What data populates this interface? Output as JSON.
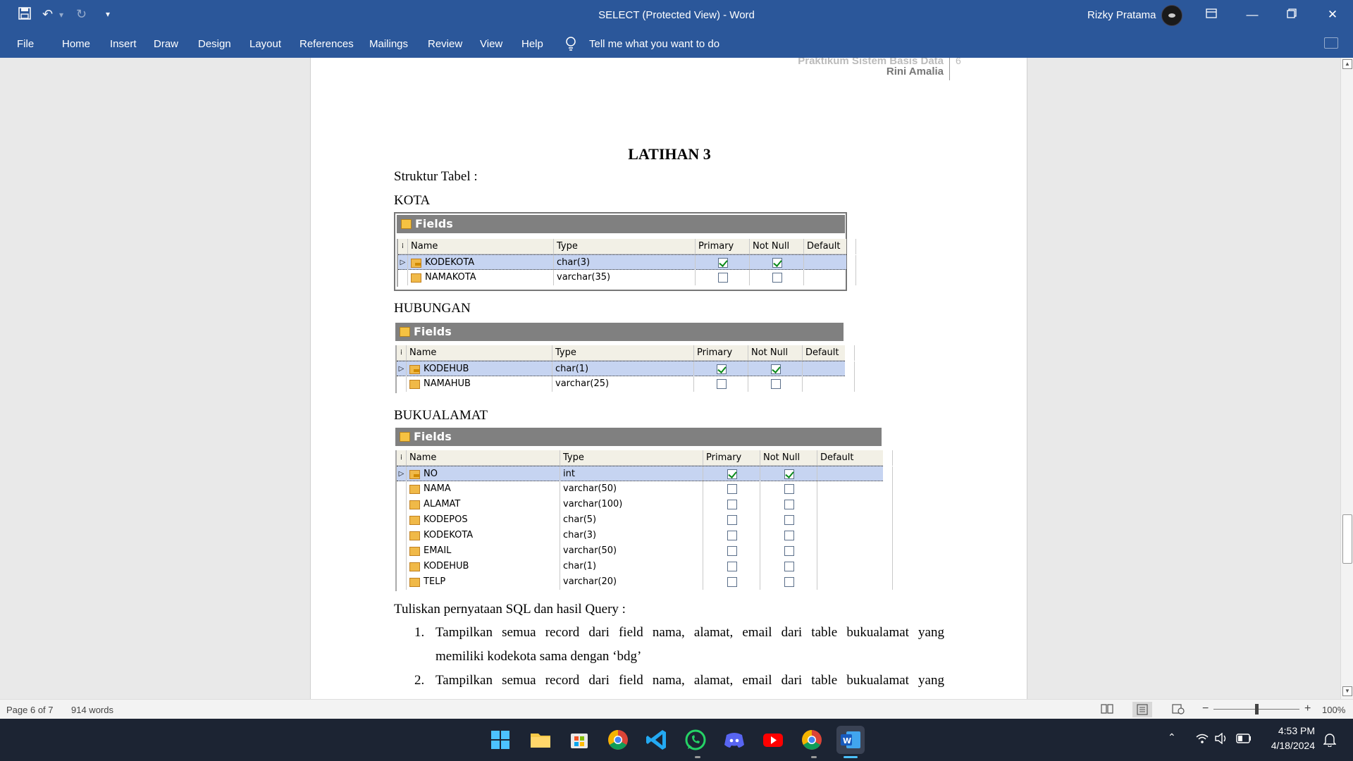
{
  "titlebar": {
    "title": "SELECT (Protected View)  -  Word",
    "user": "Rizky Pratama",
    "quick_access": [
      "save-icon",
      "undo-icon",
      "redo-icon",
      "customize-icon"
    ]
  },
  "ribbon": {
    "tabs": [
      "File",
      "Home",
      "Insert",
      "Draw",
      "Design",
      "Layout",
      "References",
      "Mailings",
      "Review",
      "View",
      "Help"
    ],
    "tell_me": "Tell me what you want to do"
  },
  "document": {
    "header_line1": "Praktikum Sistem Basis Data",
    "header_author": "Rini Amalia",
    "header_page": "6",
    "heading": "LATIHAN 3",
    "struktur": "Struktur Tabel :",
    "fields_label": "Fields",
    "columns": [
      "Name",
      "Type",
      "Primary",
      "Not Null",
      "Default"
    ],
    "tables": [
      {
        "caption": "KOTA",
        "rows": [
          {
            "name": "KODEKOTA",
            "type": "char(3)",
            "primary": true,
            "notnull": true
          },
          {
            "name": "NAMAKOTA",
            "type": "varchar(35)",
            "primary": false,
            "notnull": false
          }
        ]
      },
      {
        "caption": "HUBUNGAN",
        "rows": [
          {
            "name": "KODEHUB",
            "type": "char(1)",
            "primary": true,
            "notnull": true
          },
          {
            "name": "NAMAHUB",
            "type": "varchar(25)",
            "primary": false,
            "notnull": false
          }
        ]
      },
      {
        "caption": "BUKUALAMAT",
        "rows": [
          {
            "name": "NO",
            "type": "int",
            "primary": true,
            "notnull": true
          },
          {
            "name": "NAMA",
            "type": "varchar(50)",
            "primary": false,
            "notnull": false
          },
          {
            "name": "ALAMAT",
            "type": "varchar(100)",
            "primary": false,
            "notnull": false
          },
          {
            "name": "KODEPOS",
            "type": "char(5)",
            "primary": false,
            "notnull": false
          },
          {
            "name": "KODEKOTA",
            "type": "char(3)",
            "primary": false,
            "notnull": false
          },
          {
            "name": "EMAIL",
            "type": "varchar(50)",
            "primary": false,
            "notnull": false
          },
          {
            "name": "KODEHUB",
            "type": "char(1)",
            "primary": false,
            "notnull": false
          },
          {
            "name": "TELP",
            "type": "varchar(20)",
            "primary": false,
            "notnull": false
          }
        ]
      }
    ],
    "question": "Tuliskan pernyataan SQL dan hasil Query :",
    "items": [
      {
        "num": "1.",
        "line1": "Tampilkan semua record dari field nama, alamat, email dari table bukualamat yang",
        "line2": "memiliki kodekota sama dengan ‘bdg’"
      },
      {
        "num": "2.",
        "line1": "Tampilkan semua record dari field nama, alamat, email dari table bukualamat yang"
      }
    ]
  },
  "statusbar": {
    "page": "Page 6 of 7",
    "words": "914 words",
    "zoom": "100%"
  },
  "taskbar": {
    "time": "4:53 PM",
    "date": "4/18/2024",
    "apps": [
      "windows-start-icon",
      "file-explorer-icon",
      "microsoft-store-icon",
      "chrome-icon",
      "vscode-icon",
      "whatsapp-icon",
      "discord-icon",
      "youtube-icon",
      "chrome-profile-icon",
      "word-icon"
    ]
  },
  "colors": {
    "accent": "#2b579a",
    "taskbar": "#1c2433",
    "selected_row": "#c6d4f1"
  }
}
